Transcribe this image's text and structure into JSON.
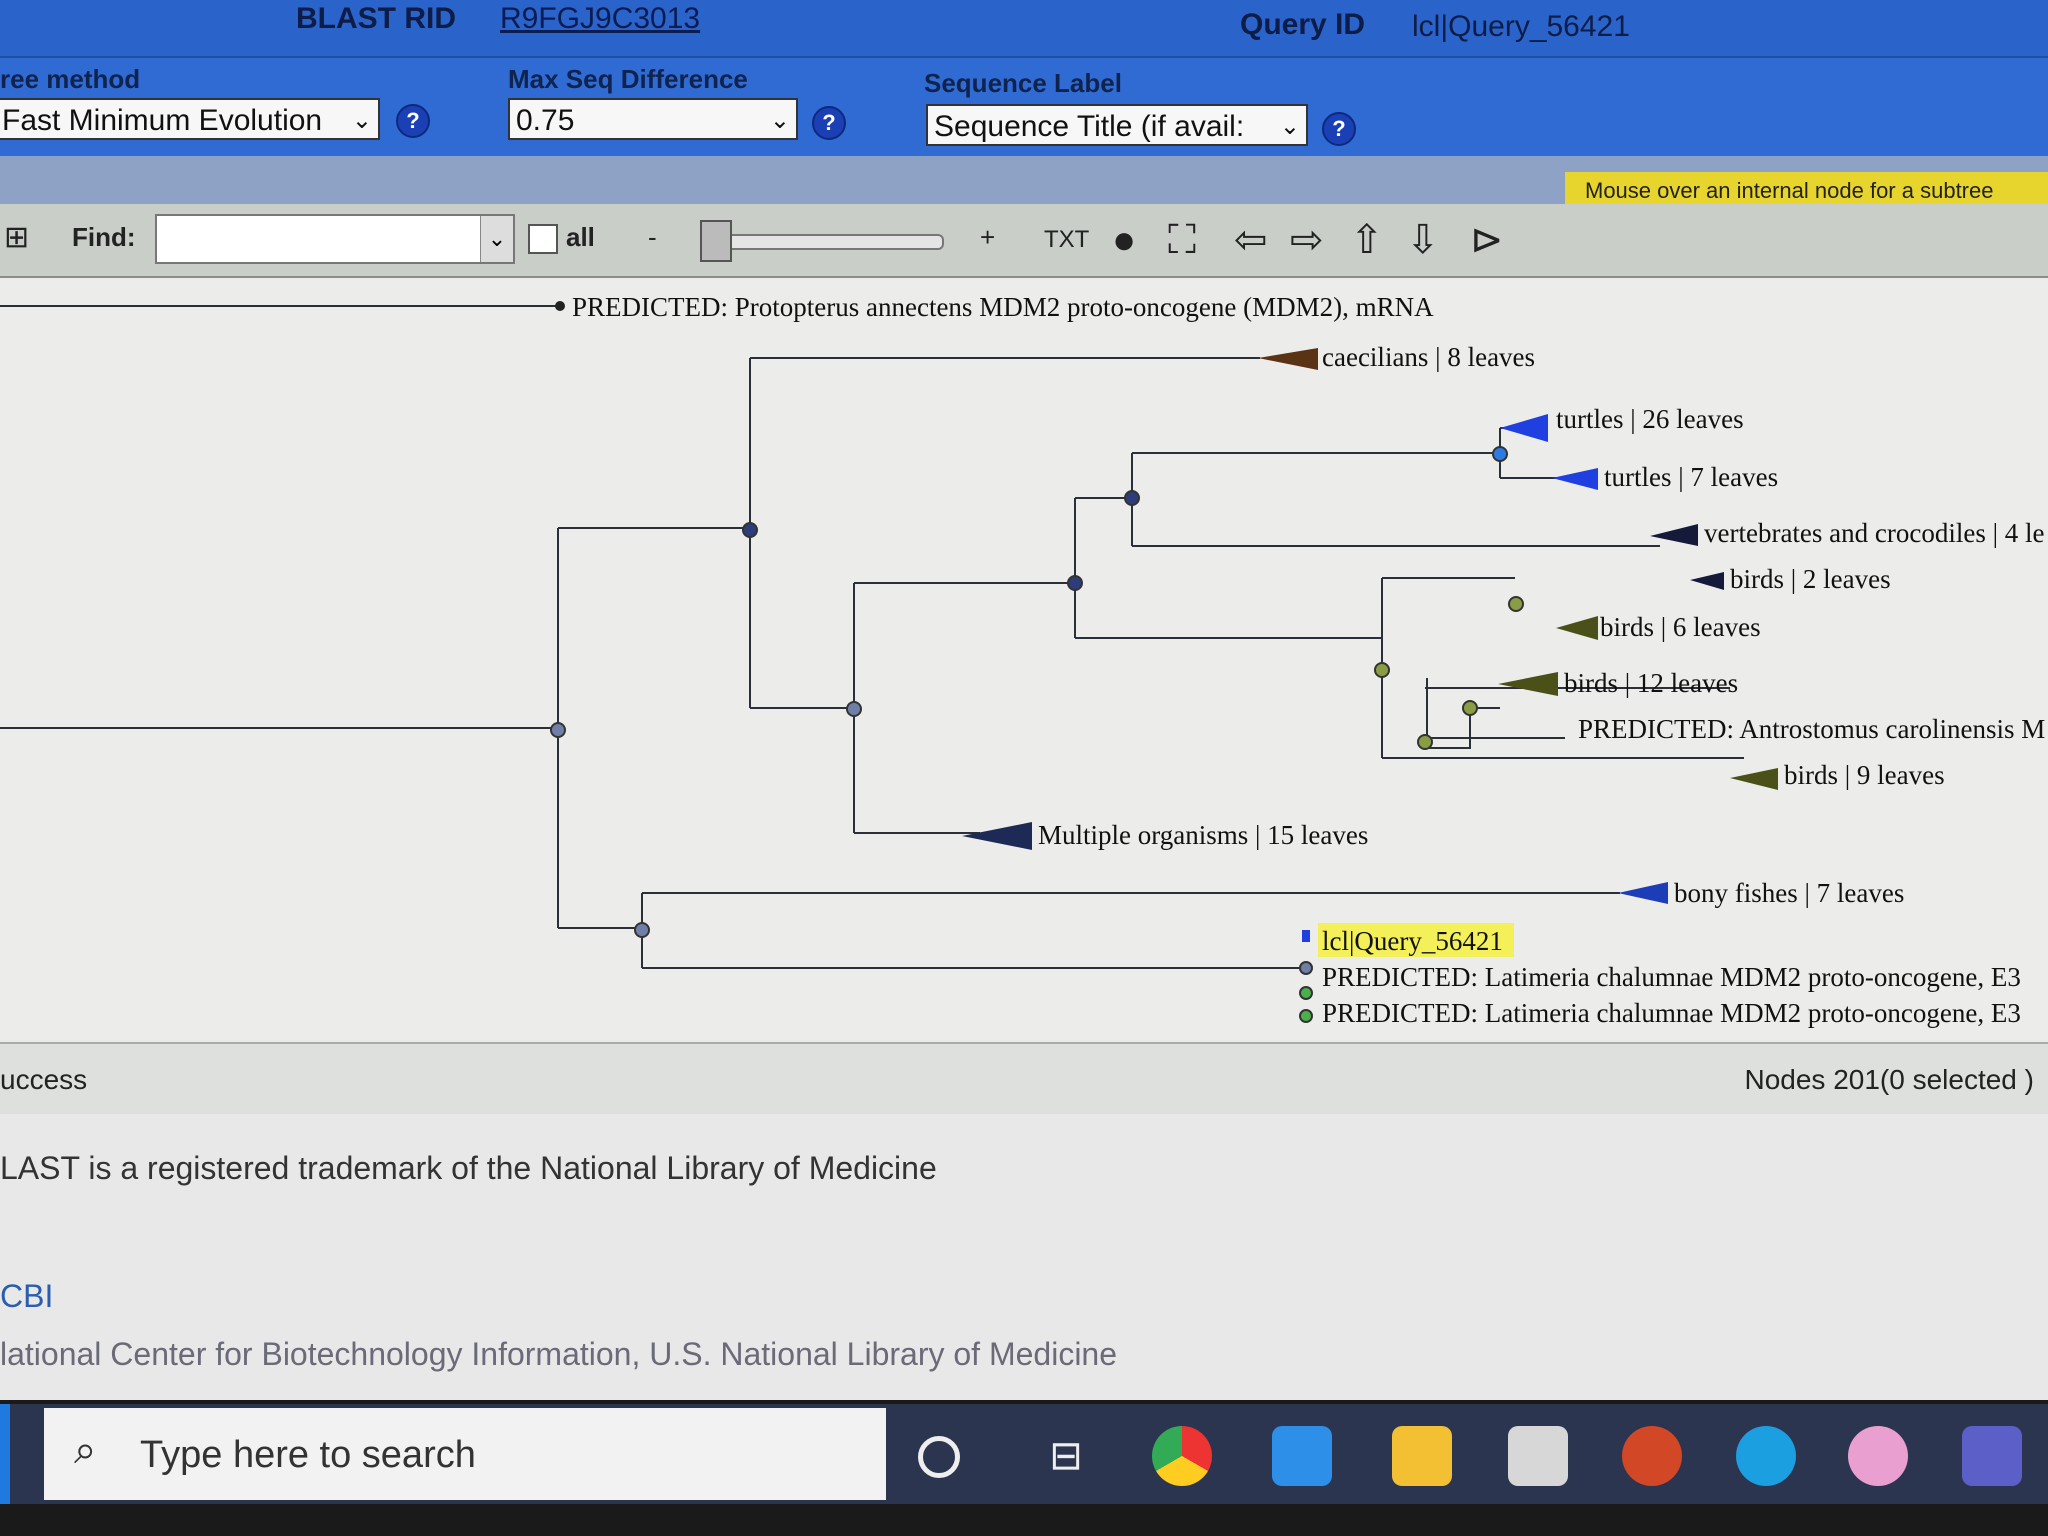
{
  "header": {
    "rid_label": "BLAST RID",
    "rid_value": "R9FGJ9C3013",
    "query_label": "Query ID",
    "query_value": "lcl|Query_56421"
  },
  "options": {
    "tree_method_label": "ree method",
    "tree_method_value": "Fast Minimum Evolution",
    "max_seq_label": "Max Seq Difference",
    "max_seq_value": "0.75",
    "seq_label_label": "Sequence Label",
    "seq_label_value": "Sequence Title (if avail:"
  },
  "hint": "Mouse over an internal node for a subtree",
  "toolbar": {
    "find_label": "Find:",
    "all_label": "all",
    "minus": "-",
    "plus": "+",
    "txt": "TXT"
  },
  "tree": {
    "leaves": [
      "PREDICTED: Protopterus annectens MDM2 proto-oncogene (MDM2), mRNA",
      "caecilians | 8 leaves",
      "turtles | 26 leaves",
      "turtles | 7 leaves",
      "vertebrates and crocodiles | 4 le",
      "birds | 2 leaves",
      "birds | 6 leaves",
      "birds | 12 leaves",
      "PREDICTED: Antrostomus carolinensis M",
      "birds | 9 leaves",
      "Multiple organisms | 15 leaves",
      "bony fishes | 7 leaves",
      "lcl|Query_56421",
      "PREDICTED: Latimeria chalumnae MDM2 proto-oncogene, E3",
      "PREDICTED: Latimeria chalumnae MDM2 proto-oncogene, E3"
    ],
    "colors": {
      "caecilians": "#5a3214",
      "turtles": "#1f3fe0",
      "vertebrates": "#151a3a",
      "birds": "#4a5018",
      "multiple": "#1c2a55",
      "fishes": "#1c3cb8",
      "highlight": "#f3f05a"
    }
  },
  "status": {
    "left": "uccess",
    "right": "Nodes 201(0 selected )"
  },
  "footer": {
    "trademark": "LAST is a registered trademark of the National Library of Medicine",
    "ncbi": "CBI",
    "ncbi_full": "lational Center for Biotechnology Information, U.S. National Library of Medicine"
  },
  "taskbar": {
    "search_placeholder": "Type here to search",
    "icons": [
      "cortana-icon",
      "task-view-icon",
      "chrome-icon",
      "mail-icon",
      "file-explorer-icon",
      "store-icon",
      "powerpoint-icon",
      "edge-icon",
      "itunes-icon",
      "teams-icon"
    ]
  }
}
